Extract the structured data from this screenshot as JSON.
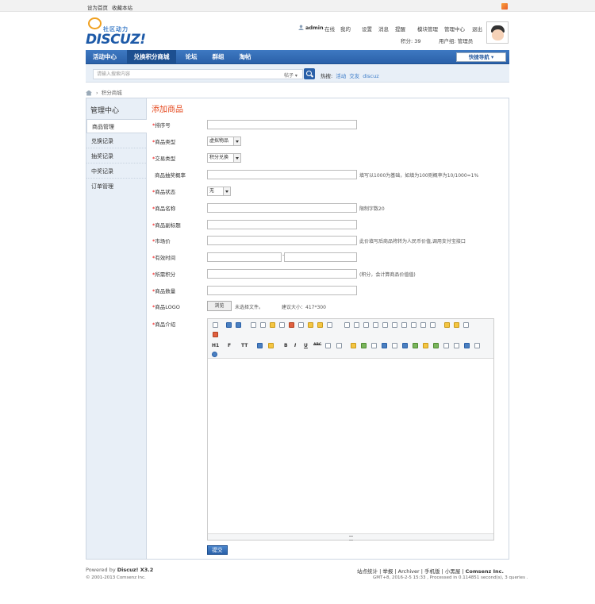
{
  "topbar": {
    "set_home": "设为首页",
    "bookmark": "收藏本站"
  },
  "logo": {
    "tagline": "社区动力",
    "brand": "DISCUZ!"
  },
  "user": {
    "icon": "user-icon",
    "name": "admin",
    "status": "在线",
    "links": [
      "我的",
      "设置",
      "消息",
      "提醒",
      "模块管理",
      "管理中心",
      "退出"
    ],
    "credits": "积分: 39",
    "group": "用户组: 管理员"
  },
  "nav": {
    "items": [
      "活动中心",
      "兑换积分商城",
      "论坛",
      "群组",
      "淘帖"
    ],
    "selected": 1,
    "quick_nav": "快捷导航"
  },
  "search": {
    "placeholder": "请输入搜索内容",
    "mode": "帖子",
    "hot_label": "热搜:",
    "hot_items": [
      "活动",
      "交友",
      "discuz"
    ]
  },
  "breadcrumb": {
    "current": "积分商城"
  },
  "sidebar": {
    "title": "管理中心",
    "items": [
      "商品管理",
      "兑换记录",
      "抽奖记录",
      "中奖记录",
      "订单管理"
    ],
    "selected": 0
  },
  "form": {
    "title": "添加商品",
    "required_mark": "*",
    "fields": {
      "sort": {
        "label": "排序号"
      },
      "type": {
        "label": "商品类型",
        "value": "虚拟物品"
      },
      "trade": {
        "label": "交易类型",
        "value": "积分兑换"
      },
      "prob": {
        "label": "商品抽奖概率",
        "hint": "填写以1000为基础，如填为100则概率为10/1000=1%"
      },
      "status": {
        "label": "商品状态",
        "value": "无"
      },
      "name": {
        "label": "商品名称",
        "hint": "限制字数20"
      },
      "subtitle": {
        "label": "商品副标题"
      },
      "price": {
        "label": "市场价",
        "hint": "此价填写后商品将转为人民币价值,调用支付宝接口"
      },
      "time": {
        "label": "有效时间",
        "sep": "-"
      },
      "credit": {
        "label": "所需积分",
        "hint": "(积分，会计算商品价值值)"
      },
      "qty": {
        "label": "商品数量"
      },
      "logo": {
        "label": "商品LOGO",
        "button": "浏览",
        "file_status": "未选择文件。",
        "hint": "建议大小：417*300"
      },
      "intro": {
        "label": "商品介绍"
      }
    },
    "submit": "提交"
  },
  "editor": {
    "row2_text": {
      "heading": "H1",
      "font": "F",
      "size": "TT",
      "bold": "B",
      "italic": "I",
      "underline": "U",
      "strike": "ABC"
    }
  },
  "footer": {
    "powered": "Powered by",
    "product": "Discuz! X3.2",
    "copyright": "© 2001-2013 Comsenz Inc.",
    "links": [
      "站点统计",
      "举报",
      "Archiver",
      "手机版",
      "小黑屋",
      "Comsenz Inc."
    ],
    "timing": "GMT+8, 2016-2-5 15:33 , Processed in 0.114851 second(s), 3 queries ."
  }
}
